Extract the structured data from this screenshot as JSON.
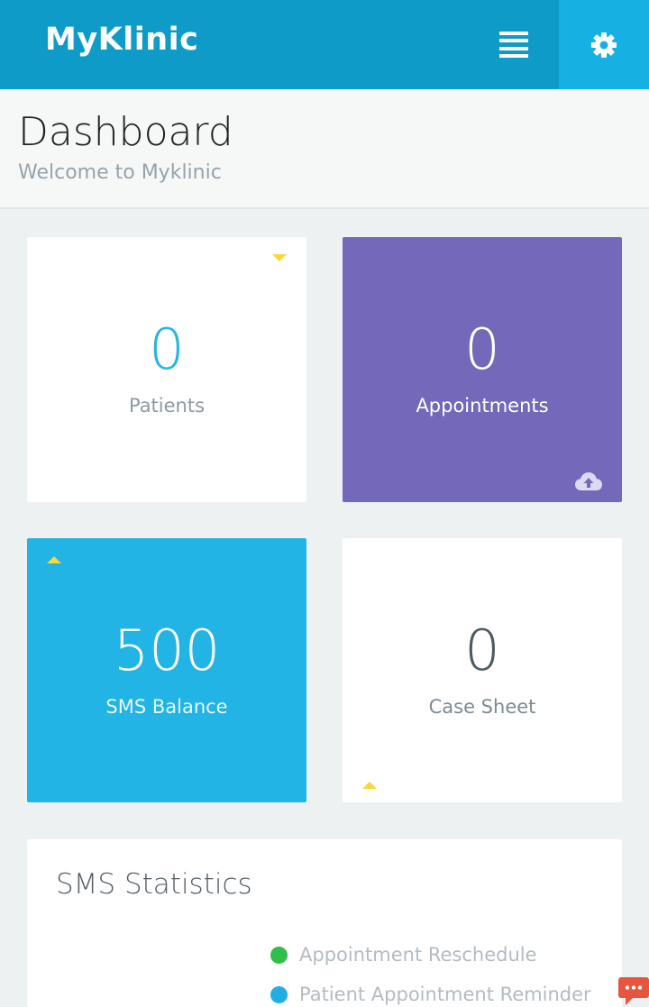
{
  "header": {
    "brand": "MyKlinic",
    "bg_color": "#0e9bc8",
    "settings_bg_color": "#17b0e2"
  },
  "page": {
    "title": "Dashboard",
    "subtitle": "Welcome to Myklinic"
  },
  "cards": {
    "patients": {
      "value": "0",
      "label": "Patients",
      "trend": "down"
    },
    "appointments": {
      "value": "0",
      "label": "Appointments",
      "icon": "cloud-upload-icon",
      "color": "#7468ba"
    },
    "sms_balance": {
      "value": "500",
      "label": "SMS Balance",
      "trend": "up",
      "color": "#21b4e4"
    },
    "case_sheet": {
      "value": "0",
      "label": "Case Sheet",
      "trend": "up"
    }
  },
  "sms_statistics": {
    "title": "SMS Statistics",
    "legend": [
      {
        "label": "Appointment Reschedule",
        "color": "#2fbf4a"
      },
      {
        "label": "Patient Appointment Reminder",
        "color": "#22aee4"
      }
    ]
  },
  "colors": {
    "trend_indicator": "#f6d83a",
    "chat_button": "#e8553e"
  }
}
